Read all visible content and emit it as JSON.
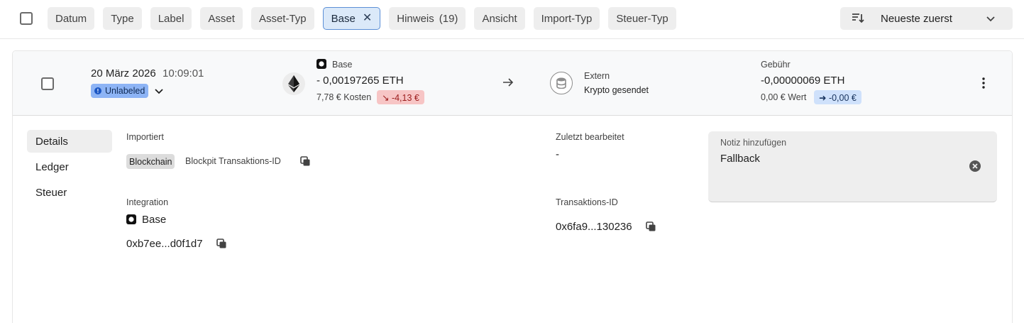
{
  "filters": {
    "chips": [
      {
        "label": "Datum"
      },
      {
        "label": "Type"
      },
      {
        "label": "Label"
      },
      {
        "label": "Asset"
      },
      {
        "label": "Asset-Typ"
      },
      {
        "label": "Base",
        "active": true
      },
      {
        "label": "Hinweis",
        "count": "(19)"
      },
      {
        "label": "Ansicht"
      },
      {
        "label": "Import-Typ"
      },
      {
        "label": "Steuer-Typ"
      }
    ],
    "sort_label": "Neueste zuerst"
  },
  "transaction": {
    "date": "20 März 2026",
    "time": "10:09:01",
    "label_badge": "Unlabeled",
    "asset_network": "Base",
    "amount": "- 0,00197265 ETH",
    "cost": "7,78 € Kosten",
    "loss": "↘ -4,13 €",
    "counterparty": "Extern",
    "direction": "Krypto gesendet",
    "fee_label": "Gebühr",
    "fee_amount": "-0,00000069 ETH",
    "fee_value": "0,00 € Wert",
    "fee_change": "➜ -0,00 €"
  },
  "details": {
    "nav": [
      "Details",
      "Ledger",
      "Steuer"
    ],
    "imported_label": "Importiert",
    "imported_badge": "Blockchain",
    "imported_id_label": "Blockpit Transaktions-ID",
    "integration_label": "Integration",
    "integration_name": "Base",
    "integration_address": "0xb7ee...d0f1d7",
    "last_edited_label": "Zuletzt bearbeitet",
    "last_edited_value": "-",
    "tx_id_label": "Transaktions-ID",
    "tx_id_value": "0x6fa9...130236",
    "note_label": "Notiz hinzufügen",
    "note_value": "Fallback"
  },
  "colors": {
    "active_chip_bg": "#dbe9f9",
    "active_chip_border": "#5b8fd6",
    "unlabeled_badge": "#8db4f5",
    "loss_badge": "#f7c5c5",
    "fee_badge": "#cfe1fb"
  },
  "icons": [
    "checkbox-icon",
    "close-icon",
    "sort-icon",
    "chevron-down-icon",
    "ethereum-icon",
    "base-network-icon",
    "arrow-right-icon",
    "database-icon",
    "more-vertical-icon",
    "copy-icon",
    "clear-icon",
    "info-icon"
  ]
}
